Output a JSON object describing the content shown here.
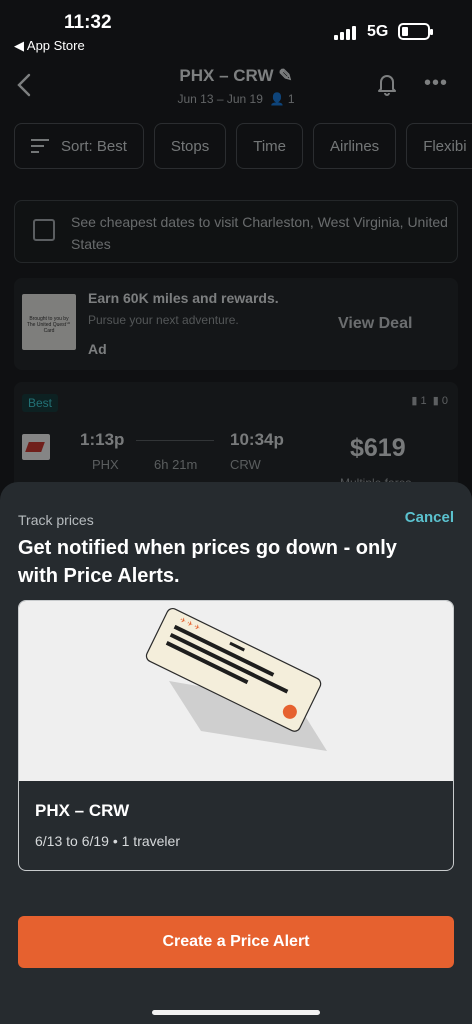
{
  "status_bar": {
    "time": "11:32",
    "back_app": "◀ App Store",
    "network": "5G"
  },
  "header": {
    "route": "PHX – CRW",
    "dates": "Jun 13 – Jun 19",
    "travelers": "1"
  },
  "filters": [
    "Sort: Best",
    "Stops",
    "Time",
    "Airlines",
    "Flexibi"
  ],
  "cheapest_dates": {
    "text": "See cheapest dates to visit Charleston, West Virginia, United States"
  },
  "ad": {
    "logo_text": "Brought to you by The United Quest℠ Card",
    "title": "Earn 60K miles and rewards.",
    "subtitle": "Pursue your next adventure.",
    "badge": "Ad",
    "cta": "View Deal"
  },
  "flight": {
    "tag": "Best",
    "bags_carry": "1",
    "bags_checked": "0",
    "depart_time": "1:13p",
    "depart_code": "PHX",
    "duration": "6h 21m",
    "arrive_time": "10:34p",
    "arrive_code": "CRW",
    "price": "$619",
    "fare_note": "Multiple fares"
  },
  "sheet": {
    "label": "Track prices",
    "cancel": "Cancel",
    "title": "Get notified when prices go down - only with Price Alerts.",
    "card": {
      "route": "PHX – CRW",
      "details": "6/13 to 6/19 • 1 traveler"
    },
    "cta": "Create a Price Alert"
  },
  "colors": {
    "accent": "#e6612f",
    "link": "#5bc2cf",
    "best_tag": "#3cc1c9"
  }
}
